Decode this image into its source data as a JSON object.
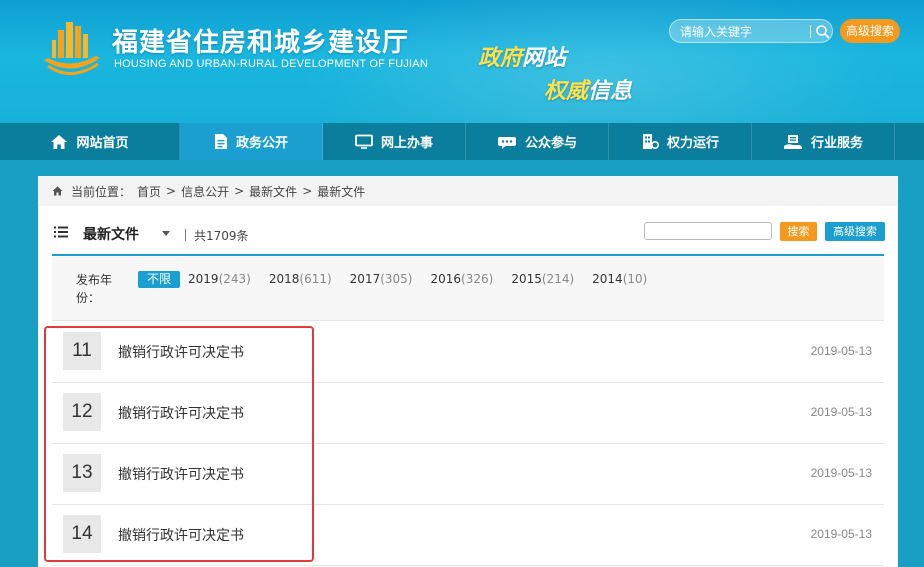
{
  "header": {
    "title": "福建省住房和城乡建设厅",
    "subtitle": "HOUSING AND URBAN-RURAL DEVELOPMENT OF FUJIAN",
    "slogan_line1_yellow": "政府",
    "slogan_line1_white": "网站",
    "slogan_line2_yellow": "权威",
    "slogan_line2_white": "信息",
    "search_placeholder": "请输入关键字",
    "advanced_search": "高级搜索"
  },
  "nav": {
    "items": [
      {
        "label": "网站首页",
        "icon": "home-icon"
      },
      {
        "label": "政务公开",
        "icon": "document-icon",
        "active": true
      },
      {
        "label": "网上办事",
        "icon": "monitor-icon"
      },
      {
        "label": "公众参与",
        "icon": "chat-icon"
      },
      {
        "label": "权力运行",
        "icon": "building-icon"
      },
      {
        "label": "行业服务",
        "icon": "service-icon"
      }
    ]
  },
  "breadcrumb": {
    "prefix": "当前位置：",
    "items": [
      "首页",
      "信息公开",
      "最新文件",
      "最新文件"
    ]
  },
  "list_header": {
    "title": "最新文件",
    "count_text": "共1709条",
    "search_button": "搜索",
    "advanced_button": "高级搜索"
  },
  "year_filter": {
    "label": "发布年份：",
    "chips": [
      {
        "label": "不限",
        "count": "",
        "active": true
      },
      {
        "label": "2019",
        "count": "(243)"
      },
      {
        "label": "2018",
        "count": "(611)"
      },
      {
        "label": "2017",
        "count": "(305)"
      },
      {
        "label": "2016",
        "count": "(326)"
      },
      {
        "label": "2015",
        "count": "(214)"
      },
      {
        "label": "2014",
        "count": "(10)"
      }
    ]
  },
  "rows": [
    {
      "num": "11",
      "title": "撤销行政许可决定书",
      "date": "2019-05-13"
    },
    {
      "num": "12",
      "title": "撤销行政许可决定书",
      "date": "2019-05-13"
    },
    {
      "num": "13",
      "title": "撤销行政许可决定书",
      "date": "2019-05-13"
    },
    {
      "num": "14",
      "title": "撤销行政许可决定书",
      "date": "2019-05-13"
    }
  ],
  "colors": {
    "brand_blue": "#1a9fd0",
    "nav_dark": "#0b7d9d",
    "accent_orange": "#f39a1e",
    "highlight_red": "#e03a3a"
  }
}
